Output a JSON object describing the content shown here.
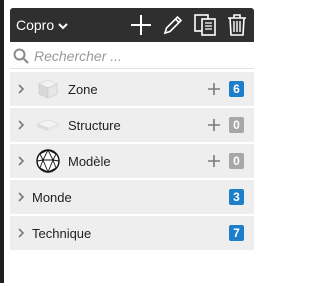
{
  "toolbar": {
    "dropdown_label": "Copro",
    "icons": [
      "plus-icon",
      "pencil-icon",
      "copy-icon",
      "trash-icon"
    ]
  },
  "search": {
    "placeholder": "Rechercher ..."
  },
  "items": [
    {
      "label": "Zone",
      "count": "6",
      "badge_color": "#1d7fc9",
      "has_add": true,
      "thumb": "cube-icon"
    },
    {
      "label": "Structure",
      "count": "0",
      "badge_color": "#a7a7a7",
      "has_add": true,
      "thumb": "slab-icon"
    },
    {
      "label": "Modèle",
      "count": "0",
      "badge_color": "#a7a7a7",
      "has_add": true,
      "thumb": "wireframe-sphere-icon"
    },
    {
      "label": "Monde",
      "count": "3",
      "badge_color": "#1d7fc9",
      "has_add": false
    },
    {
      "label": "Technique",
      "count": "7",
      "badge_color": "#1d7fc9",
      "has_add": false
    }
  ]
}
